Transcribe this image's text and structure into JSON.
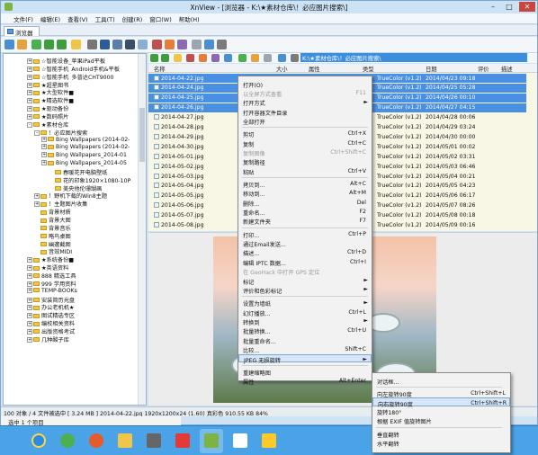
{
  "window": {
    "title": "XnView - [浏览器 - K:\\★素材仓库\\！必应图片搜索\\]"
  },
  "menu": [
    "文件(F)",
    "编辑(E)",
    "查看(V)",
    "工具(T)",
    "创建(R)",
    "窗口(W)",
    "帮助(H)"
  ],
  "tab": "浏览器",
  "path": "K:\\★素材仓库\\！必应图片搜索\\",
  "tree": [
    {
      "label": "☆智能设备_苹果iPad平板",
      "exp": "+"
    },
    {
      "label": "☆智能手机_Android手机&平板",
      "exp": "+"
    },
    {
      "label": "☆智能手机_多普达CHT9000",
      "exp": "+"
    },
    {
      "label": "★超星图书",
      "exp": "+"
    },
    {
      "label": "★大型软件■",
      "exp": "+"
    },
    {
      "label": "★精选软件■",
      "exp": "+"
    },
    {
      "label": "★驱动备份",
      "exp": "+"
    },
    {
      "label": "★数码照片",
      "exp": "+"
    },
    {
      "label": "★素材仓库",
      "exp": "-"
    },
    {
      "label": "！必应图片搜索",
      "exp": "-"
    },
    {
      "label": "Bing Wallpapers (2014-02-",
      "exp": "+"
    },
    {
      "label": "Bing Wallpapers (2014-02-",
      "exp": "+"
    },
    {
      "label": "Bing Wallpapers_2014-01",
      "exp": "+"
    },
    {
      "label": "Bing Wallpapers_2014-05",
      "exp": "+"
    },
    {
      "label": "春暖花开电脑壁纸",
      "exp": ""
    },
    {
      "label": "花的印象1920×1080-10P",
      "exp": ""
    },
    {
      "label": "美央他伦珊瑚画",
      "exp": ""
    },
    {
      "label": "！野机下载的Win8主题",
      "exp": "+"
    },
    {
      "label": "！主题图片收集",
      "exp": "+"
    },
    {
      "label": "背景材质",
      "exp": ""
    },
    {
      "label": "背景大图",
      "exp": ""
    },
    {
      "label": "背景音乐",
      "exp": ""
    },
    {
      "label": "略鸟桌图",
      "exp": ""
    },
    {
      "label": "幽邃截图",
      "exp": ""
    },
    {
      "label": "音效MIDI",
      "exp": ""
    },
    {
      "label": "★系统备份■",
      "exp": "+"
    },
    {
      "label": "★英语资料",
      "exp": "+"
    },
    {
      "label": "888 精选工具",
      "exp": "+"
    },
    {
      "label": "999 学用资料",
      "exp": "+"
    },
    {
      "label": "TEMP-BOOKs",
      "exp": "+"
    },
    {
      "label": "安装简历光盘",
      "exp": "+"
    },
    {
      "label": "办公老机机★",
      "exp": "+"
    },
    {
      "label": "图试精选专区",
      "exp": "+"
    },
    {
      "label": "编校相关资料",
      "exp": "+"
    },
    {
      "label": "出版资格考试",
      "exp": "+"
    },
    {
      "label": "几种酸子库",
      "exp": "+"
    }
  ],
  "columns": {
    "name": "名称",
    "size": "大小",
    "attr": "属性",
    "type": "类型",
    "date": "日期",
    "rating": "评价",
    "desc": "描述"
  },
  "files": [
    {
      "name": "2014-04-22.jpg",
      "type": "TrueColor (v1.2)",
      "date": "2014/04/23 09:18",
      "sel": true
    },
    {
      "name": "2014-04-24.jpg",
      "type": "TrueColor (v1.2)",
      "date": "2014/04/25 05:28",
      "sel": true
    },
    {
      "name": "2014-04-25.jpg",
      "type": "TrueColor (v1.2)",
      "date": "2014/04/26 00:10",
      "sel": true
    },
    {
      "name": "2014-04-26.jpg",
      "type": "TrueColor (v1.2)",
      "date": "2014/04/27 04:15",
      "sel": true
    },
    {
      "name": "2014-04-27.jpg",
      "type": "TrueColor (v1.2)",
      "date": "2014/04/28 00:06",
      "sel": false
    },
    {
      "name": "2014-04-28.jpg",
      "type": "TrueColor (v1.2)",
      "date": "2014/04/29 03:24",
      "sel": false
    },
    {
      "name": "2014-04-29.jpg",
      "type": "TrueColor (v1.2)",
      "date": "2014/04/30 00:00",
      "sel": false
    },
    {
      "name": "2014-04-30.jpg",
      "type": "TrueColor (v1.2)",
      "date": "2014/05/01 00:02",
      "sel": false
    },
    {
      "name": "2014-05-01.jpg",
      "type": "TrueColor (v1.2)",
      "date": "2014/05/02 03:31",
      "sel": false
    },
    {
      "name": "2014-05-02.jpg",
      "type": "TrueColor (v1.2)",
      "date": "2014/05/03 06:46",
      "sel": false
    },
    {
      "name": "2014-05-03.jpg",
      "type": "TrueColor (v1.2)",
      "date": "2014/05/04 00:21",
      "sel": false
    },
    {
      "name": "2014-05-04.jpg",
      "type": "TrueColor (v1.2)",
      "date": "2014/05/05 04:23",
      "sel": false
    },
    {
      "name": "2014-05-05.jpg",
      "type": "TrueColor (v1.2)",
      "date": "2014/05/06 06:17",
      "sel": false
    },
    {
      "name": "2014-05-06.jpg",
      "type": "TrueColor (v1.2)",
      "date": "2014/05/07 08:26",
      "sel": false
    },
    {
      "name": "2014-05-07.jpg",
      "type": "TrueColor (v1.2)",
      "date": "2014/05/08 00:18",
      "sel": false
    },
    {
      "name": "2014-05-08.jpg",
      "type": "TrueColor (v1.2)",
      "date": "2014/05/09 00:16",
      "sel": false
    }
  ],
  "context_menu": [
    {
      "label": "打开(O)",
      "shortcut": "",
      "state": ""
    },
    {
      "label": "以全屏方式查看",
      "shortcut": "F11",
      "state": "dis"
    },
    {
      "label": "打开方式",
      "shortcut": "",
      "state": "",
      "arrow": true
    },
    {
      "label": "打开容器文件目录",
      "shortcut": "",
      "state": ""
    },
    {
      "label": "全部打开",
      "shortcut": "",
      "state": ""
    },
    {
      "sep": true
    },
    {
      "label": "剪切",
      "shortcut": "Ctrl+X",
      "state": ""
    },
    {
      "label": "复制",
      "shortcut": "Ctrl+C",
      "state": ""
    },
    {
      "label": "复制图像",
      "shortcut": "Ctrl+Shift+C",
      "state": "dis"
    },
    {
      "label": "复制路径",
      "shortcut": "",
      "state": ""
    },
    {
      "label": "粘贴",
      "shortcut": "Ctrl+V",
      "state": ""
    },
    {
      "sep": true
    },
    {
      "label": "拷贝到...",
      "shortcut": "Alt+C",
      "state": ""
    },
    {
      "label": "移动到...",
      "shortcut": "Alt+M",
      "state": ""
    },
    {
      "label": "删除...",
      "shortcut": "Del",
      "state": ""
    },
    {
      "label": "重命名...",
      "shortcut": "F2",
      "state": ""
    },
    {
      "label": "新建文件夹",
      "shortcut": "F7",
      "state": ""
    },
    {
      "sep": true
    },
    {
      "label": "打印...",
      "shortcut": "Ctrl+P",
      "state": ""
    },
    {
      "label": "通过Email发送...",
      "shortcut": "",
      "state": ""
    },
    {
      "label": "描述...",
      "shortcut": "Ctrl+D",
      "state": ""
    },
    {
      "label": "编辑 IPTC 数据...",
      "shortcut": "Ctrl+I",
      "state": ""
    },
    {
      "label": "在 GeoHack 中打开 GPS 定位",
      "shortcut": "",
      "state": "dis"
    },
    {
      "label": "标记",
      "shortcut": "",
      "state": "",
      "arrow": true
    },
    {
      "label": "评价和色彩标记",
      "shortcut": "",
      "state": "",
      "arrow": true
    },
    {
      "sep": true
    },
    {
      "label": "设置为墙纸",
      "shortcut": "",
      "state": "",
      "arrow": true
    },
    {
      "label": "幻灯播放...",
      "shortcut": "Ctrl+L",
      "state": ""
    },
    {
      "label": "转换到",
      "shortcut": "",
      "state": "",
      "arrow": true
    },
    {
      "label": "批量转换...",
      "shortcut": "Ctrl+U",
      "state": ""
    },
    {
      "label": "批量重命名...",
      "shortcut": "",
      "state": ""
    },
    {
      "label": "比较...",
      "shortcut": "Shift+C",
      "state": ""
    },
    {
      "label": "JPEG 无损旋转",
      "shortcut": "",
      "state": "hl",
      "arrow": true
    },
    {
      "sep": true
    },
    {
      "label": "重建缩略图",
      "shortcut": "",
      "state": ""
    },
    {
      "label": "属性",
      "shortcut": "Alt+Enter",
      "state": ""
    }
  ],
  "submenu": [
    {
      "label": "对话框...",
      "shortcut": "",
      "state": ""
    },
    {
      "sep": true
    },
    {
      "label": "向左旋转90度",
      "shortcut": "Ctrl+Shift+L",
      "state": ""
    },
    {
      "label": "向右旋转90度",
      "shortcut": "Ctrl+Shift+R",
      "state": "hl"
    },
    {
      "label": "旋转180°",
      "shortcut": "",
      "state": ""
    },
    {
      "label": "根据 EXIF 值旋转图片",
      "shortcut": "",
      "state": ""
    },
    {
      "sep": true
    },
    {
      "label": "垂直翻转",
      "shortcut": "",
      "state": ""
    },
    {
      "label": "水平翻转",
      "shortcut": "",
      "state": ""
    }
  ],
  "status": "100 对象 / 4 文件被选中 [ 3.24 MB ]  2014-04-22.jpg  1920x1200x24 (1.60)  真彩色  910.55 KB  84%",
  "status2": "选中 1 个项目"
}
